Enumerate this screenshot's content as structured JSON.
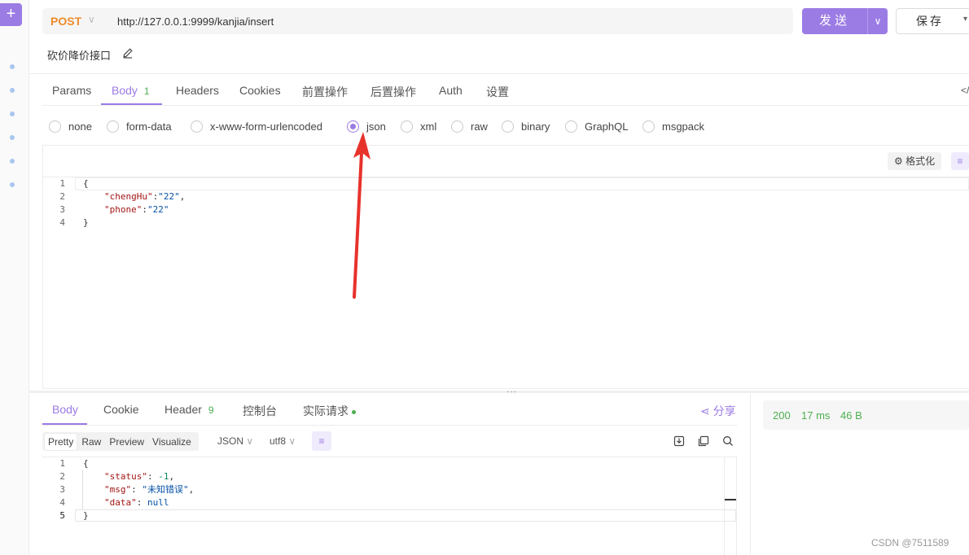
{
  "request": {
    "method": "POST",
    "url": "http://127.0.0.1:9999/kanjia/insert",
    "send_label": "发送",
    "save_label": "保存",
    "api_name": "砍价降价接口"
  },
  "request_tabs": [
    {
      "label": "Params"
    },
    {
      "label": "Body",
      "badge": "1"
    },
    {
      "label": "Headers"
    },
    {
      "label": "Cookies"
    },
    {
      "label": "前置操作"
    },
    {
      "label": "后置操作"
    },
    {
      "label": "Auth"
    },
    {
      "label": "设置"
    }
  ],
  "collapse_icon": "</",
  "body_types": [
    {
      "label": "none"
    },
    {
      "label": "form-data"
    },
    {
      "label": "x-www-form-urlencoded"
    },
    {
      "label": "json",
      "checked": true
    },
    {
      "label": "xml"
    },
    {
      "label": "raw"
    },
    {
      "label": "binary"
    },
    {
      "label": "GraphQL"
    },
    {
      "label": "msgpack"
    }
  ],
  "editor": {
    "format_label": "格式化",
    "line_numbers": [
      "1",
      "2",
      "3",
      "4"
    ],
    "lines": {
      "l1": "{",
      "l2_key": "\"chengHu\"",
      "l2_sep": ":",
      "l2_val": "\"22\"",
      "l2_end": ",",
      "l3_key": "\"phone\"",
      "l3_sep": ":",
      "l3_val": "\"22\"",
      "l4": "}"
    }
  },
  "response_tabs": [
    {
      "label": "Body"
    },
    {
      "label": "Cookie"
    },
    {
      "label": "Header",
      "badge": "9"
    },
    {
      "label": "控制台"
    },
    {
      "label": "实际请求"
    }
  ],
  "share_label": "分享",
  "status": {
    "code": "200",
    "time": "17 ms",
    "size": "46 B"
  },
  "view_modes": [
    "Pretty",
    "Raw",
    "Preview",
    "Visualize"
  ],
  "format_select": "JSON",
  "encoding_select": "utf8",
  "response": {
    "line_numbers": [
      "1",
      "2",
      "3",
      "4",
      "5"
    ],
    "lines": {
      "l1": "{",
      "l2_key": "\"status\"",
      "l2_sep": ": ",
      "l2_val": "-1",
      "l2_end": ",",
      "l3_key": "\"msg\"",
      "l3_sep": ": ",
      "l3_val": "\"未知错误\"",
      "l3_end": ",",
      "l4_key": "\"data\"",
      "l4_sep": ": ",
      "l4_val": "null",
      "l5": "}"
    }
  },
  "watermark": "CSDN @7511589",
  "colors": {
    "accent": "#9b7be4",
    "method": "#ef8a2a",
    "success": "#4caf50",
    "annotation_arrow": "#e8322c"
  }
}
